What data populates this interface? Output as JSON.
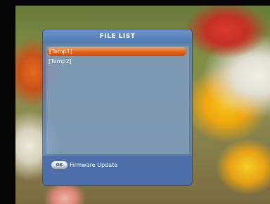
{
  "dialog": {
    "title": "FILE LIST",
    "files": [
      {
        "name": "[Temp1]",
        "selected": true
      },
      {
        "name": "[Temp2]",
        "selected": false
      }
    ]
  },
  "footer": {
    "ok_icon": "OK",
    "action_label": "Firmware Update"
  },
  "colors": {
    "dialog_blue": "#5d80b2",
    "selection_orange": "#e0641c"
  }
}
